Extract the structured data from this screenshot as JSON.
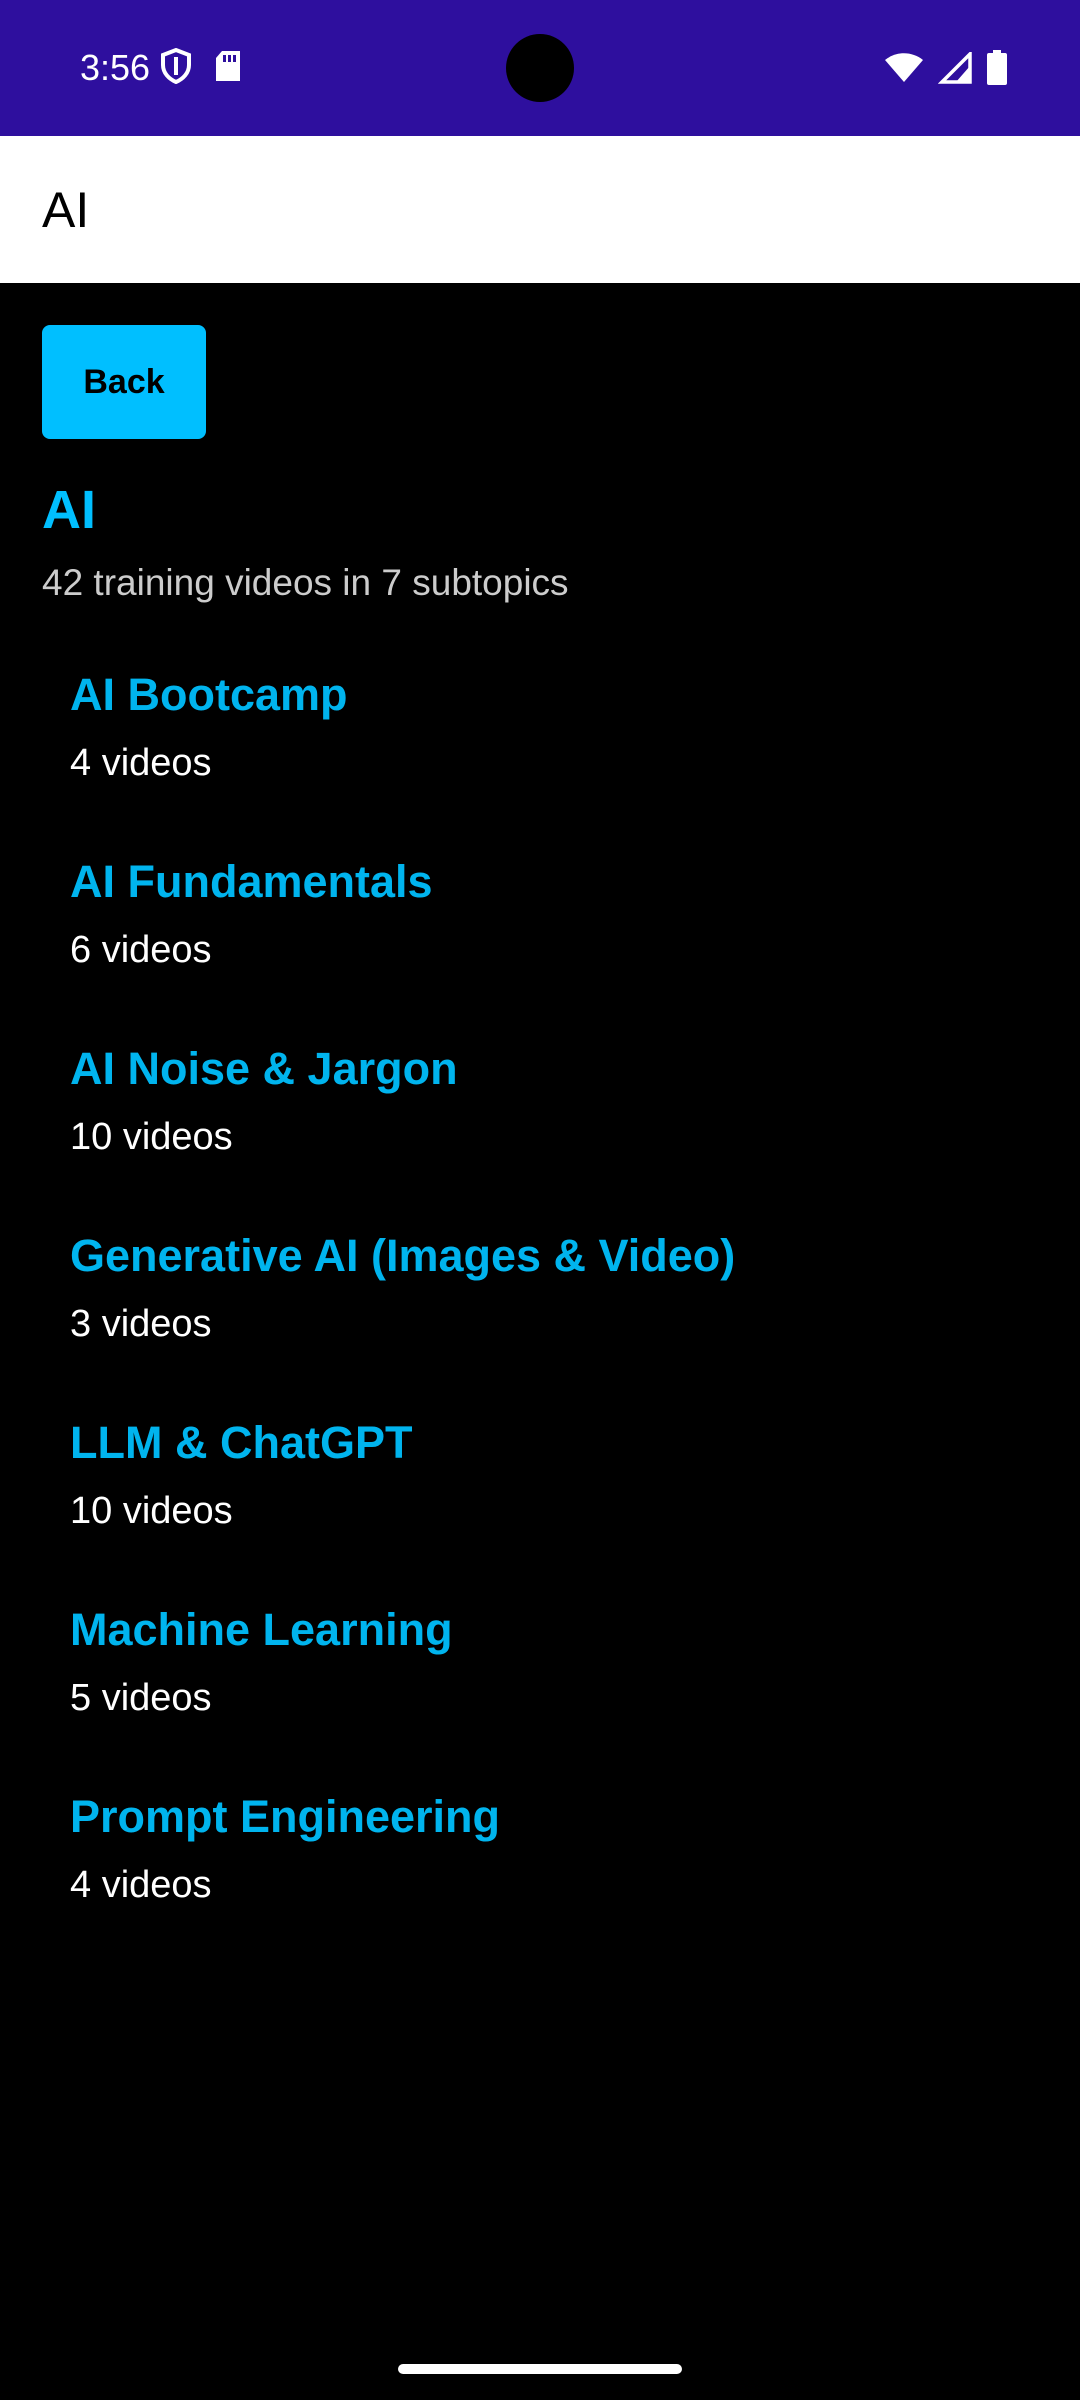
{
  "status_bar": {
    "time": "3:56",
    "icons_left": [
      "shield-icon",
      "sd-card-icon"
    ],
    "icons_right": [
      "wifi-icon",
      "cellular-signal-icon",
      "battery-icon"
    ],
    "background": "#2e0f9e"
  },
  "app_bar": {
    "title": "AI"
  },
  "back_button": {
    "label": "Back",
    "color": "#00bfff"
  },
  "topic": {
    "title": "AI",
    "summary": "42 training videos in 7 subtopics"
  },
  "subtopics": [
    {
      "name": "AI Bootcamp",
      "count": "4 videos"
    },
    {
      "name": "AI Fundamentals",
      "count": "6 videos"
    },
    {
      "name": "AI Noise & Jargon",
      "count": "10 videos"
    },
    {
      "name": "Generative AI (Images & Video)",
      "count": "3 videos"
    },
    {
      "name": "LLM & ChatGPT",
      "count": "10 videos"
    },
    {
      "name": "Machine Learning",
      "count": "5 videos"
    },
    {
      "name": "Prompt Engineering",
      "count": "4 videos"
    }
  ],
  "colors": {
    "accent": "#00bfff",
    "link": "#00b4ee",
    "background": "#000000"
  }
}
